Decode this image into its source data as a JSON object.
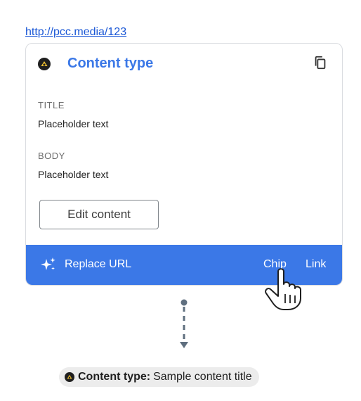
{
  "url": "http://pcc.media/123",
  "card": {
    "title": "Content type",
    "brand_icon": "pcc-logo-icon",
    "copy_icon": "copy-icon",
    "fields": [
      {
        "label": "TITLE",
        "value": "Placeholder text"
      },
      {
        "label": "BODY",
        "value": "Placeholder text"
      }
    ],
    "edit_button": "Edit content"
  },
  "action_bar": {
    "sparkle_icon": "sparkle-icon",
    "replace_label": "Replace URL",
    "chip_label": "Chip",
    "link_label": "Link",
    "color": "#3b78e7"
  },
  "result_chip": {
    "type_label": "Content type:",
    "title": "Sample content title",
    "icon": "pcc-logo-icon"
  },
  "colors": {
    "accent": "#3b78e7",
    "link": "#1a57d6",
    "chip_bg": "#ececec",
    "arrow": "#5f6f7f"
  }
}
